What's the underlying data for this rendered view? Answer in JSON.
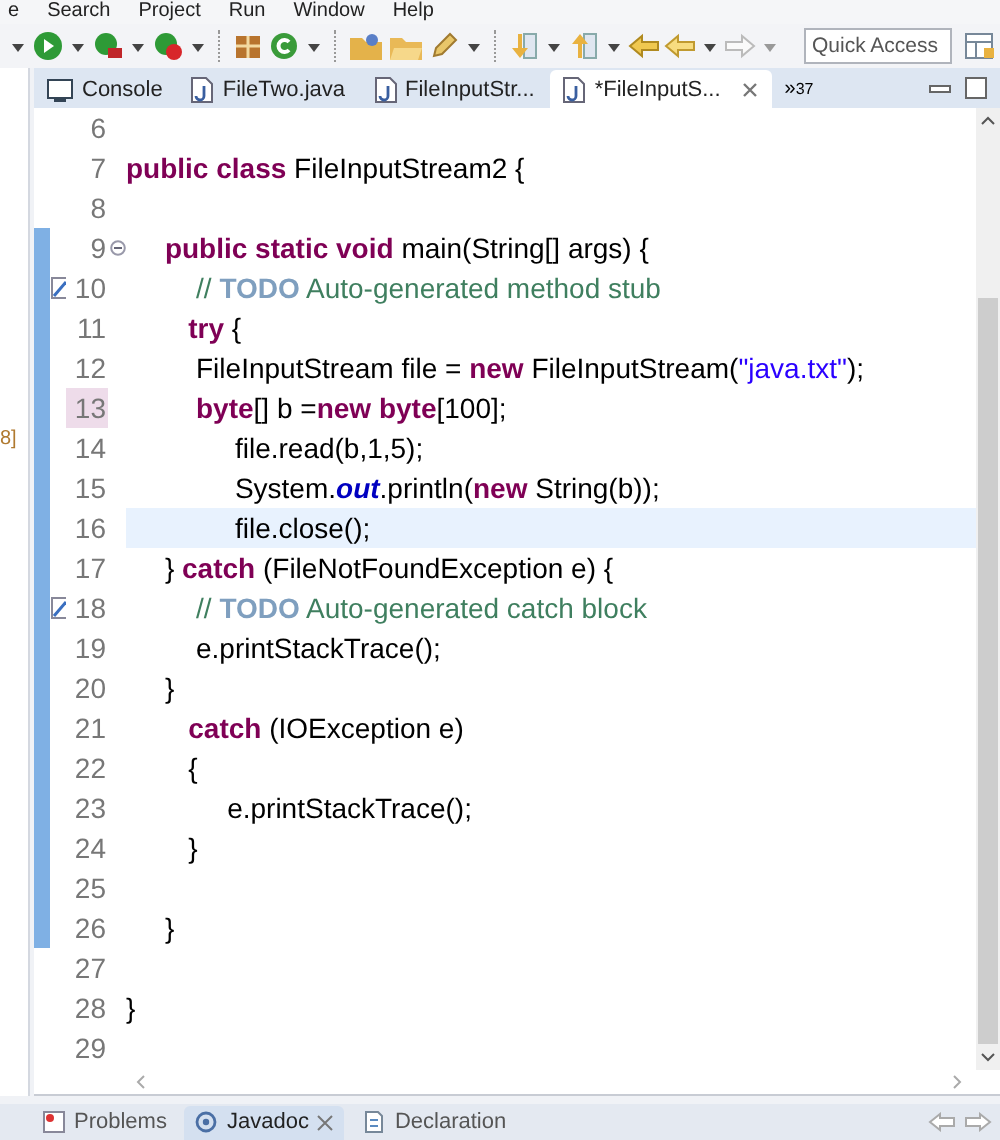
{
  "menu_bar": [
    "e",
    "Search",
    "Project",
    "Run",
    "Window",
    "Help"
  ],
  "quick_access": {
    "placeholder": "Quick Access"
  },
  "editor_tabs": [
    {
      "label": "Console",
      "kind": "console",
      "selected": false,
      "closable": false
    },
    {
      "label": "FileTwo.java",
      "kind": "java",
      "selected": false,
      "closable": false
    },
    {
      "label": "FileInputStr...",
      "kind": "java",
      "selected": false,
      "closable": false
    },
    {
      "label": "*FileInputS...",
      "kind": "java",
      "selected": true,
      "closable": true
    }
  ],
  "overflow": {
    "glyph": "»",
    "count": "37"
  },
  "side_panel_text": "8]",
  "code_lines": [
    {
      "number": "6",
      "changed": false,
      "current": false,
      "number_marked": false
    },
    {
      "number": "7",
      "changed": false,
      "current": false,
      "number_marked": false,
      "tokens": [
        {
          "kind": "keyword",
          "text": "public class"
        },
        {
          "kind": "plain",
          "text": " FileInputStream2 {"
        }
      ]
    },
    {
      "number": "8",
      "changed": false,
      "current": false,
      "number_marked": false
    },
    {
      "number": "9",
      "changed": true,
      "current": false,
      "number_marked": false,
      "fold_marker": true,
      "tokens": [
        {
          "kind": "keyword",
          "text": "     public static void"
        },
        {
          "kind": "plain",
          "text": " main(String[] args) {"
        }
      ]
    },
    {
      "number": "10",
      "changed": true,
      "current": false,
      "number_marked": false,
      "task_marker": true,
      "tokens": [
        {
          "kind": "comment",
          "text": "         // "
        },
        {
          "kind": "tag",
          "text": "TODO"
        },
        {
          "kind": "comment",
          "text": " Auto-generated method stub"
        }
      ]
    },
    {
      "number": "11",
      "changed": true,
      "current": false,
      "number_marked": false,
      "tokens": [
        {
          "kind": "keyword",
          "text": "        try"
        },
        {
          "kind": "plain",
          "text": " {"
        }
      ]
    },
    {
      "number": "12",
      "changed": true,
      "current": false,
      "number_marked": false,
      "tokens": [
        {
          "kind": "plain",
          "text": "         FileInputStream file = "
        },
        {
          "kind": "keyword",
          "text": "new"
        },
        {
          "kind": "plain",
          "text": " FileInputStream("
        },
        {
          "kind": "string",
          "text": "\"java.txt\""
        },
        {
          "kind": "plain",
          "text": ");"
        }
      ]
    },
    {
      "number": "13",
      "changed": true,
      "current": false,
      "number_marked": true,
      "tokens": [
        {
          "kind": "keyword",
          "text": "         byte"
        },
        {
          "kind": "plain",
          "text": "[] b ="
        },
        {
          "kind": "keyword",
          "text": "new byte"
        },
        {
          "kind": "plain",
          "text": "[100];"
        }
      ]
    },
    {
      "number": "14",
      "changed": true,
      "current": false,
      "number_marked": false,
      "tokens": [
        {
          "kind": "plain",
          "text": "              file.read(b,1,5);"
        }
      ]
    },
    {
      "number": "15",
      "changed": true,
      "current": false,
      "number_marked": false,
      "tokens": [
        {
          "kind": "plain",
          "text": "              System."
        },
        {
          "kind": "field",
          "text": "out"
        },
        {
          "kind": "plain",
          "text": ".println("
        },
        {
          "kind": "keyword",
          "text": "new"
        },
        {
          "kind": "plain",
          "text": " String(b));"
        }
      ]
    },
    {
      "number": "16",
      "changed": true,
      "current": true,
      "number_marked": false,
      "tokens": [
        {
          "kind": "plain",
          "text": "              file.close();"
        }
      ]
    },
    {
      "number": "17",
      "changed": true,
      "current": false,
      "number_marked": false,
      "tokens": [
        {
          "kind": "plain",
          "text": "     } "
        },
        {
          "kind": "keyword",
          "text": "catch"
        },
        {
          "kind": "plain",
          "text": " (FileNotFoundException e) {"
        }
      ]
    },
    {
      "number": "18",
      "changed": true,
      "current": false,
      "number_marked": false,
      "task_marker": true,
      "tokens": [
        {
          "kind": "comment",
          "text": "         // "
        },
        {
          "kind": "tag",
          "text": "TODO"
        },
        {
          "kind": "comment",
          "text": " Auto-generated catch block"
        }
      ]
    },
    {
      "number": "19",
      "changed": true,
      "current": false,
      "number_marked": false,
      "tokens": [
        {
          "kind": "plain",
          "text": "         e.printStackTrace();"
        }
      ]
    },
    {
      "number": "20",
      "changed": true,
      "current": false,
      "number_marked": false,
      "tokens": [
        {
          "kind": "plain",
          "text": "     }"
        }
      ]
    },
    {
      "number": "21",
      "changed": true,
      "current": false,
      "number_marked": false,
      "tokens": [
        {
          "kind": "keyword",
          "text": "        catch"
        },
        {
          "kind": "plain",
          "text": " (IOException e)"
        }
      ]
    },
    {
      "number": "22",
      "changed": true,
      "current": false,
      "number_marked": false,
      "tokens": [
        {
          "kind": "plain",
          "text": "        {"
        }
      ]
    },
    {
      "number": "23",
      "changed": true,
      "current": false,
      "number_marked": false,
      "tokens": [
        {
          "kind": "plain",
          "text": "             e.printStackTrace();"
        }
      ]
    },
    {
      "number": "24",
      "changed": true,
      "current": false,
      "number_marked": false,
      "tokens": [
        {
          "kind": "plain",
          "text": "        }"
        }
      ]
    },
    {
      "number": "25",
      "changed": true,
      "current": false,
      "number_marked": false
    },
    {
      "number": "26",
      "changed": true,
      "current": false,
      "number_marked": false,
      "tokens": [
        {
          "kind": "plain",
          "text": "     }"
        }
      ]
    },
    {
      "number": "27",
      "changed": false,
      "current": false,
      "number_marked": false
    },
    {
      "number": "28",
      "changed": false,
      "current": false,
      "number_marked": false,
      "tokens": [
        {
          "kind": "plain",
          "text": "}"
        }
      ]
    },
    {
      "number": "29",
      "changed": false,
      "current": false,
      "number_marked": false
    }
  ],
  "bottom_tabs": [
    {
      "label": "Problems",
      "kind": "problems",
      "selected": false,
      "closable": false
    },
    {
      "label": "Javadoc",
      "kind": "javadoc",
      "selected": true,
      "closable": true
    },
    {
      "label": "Declaration",
      "kind": "declaration",
      "selected": false,
      "closable": false
    }
  ]
}
